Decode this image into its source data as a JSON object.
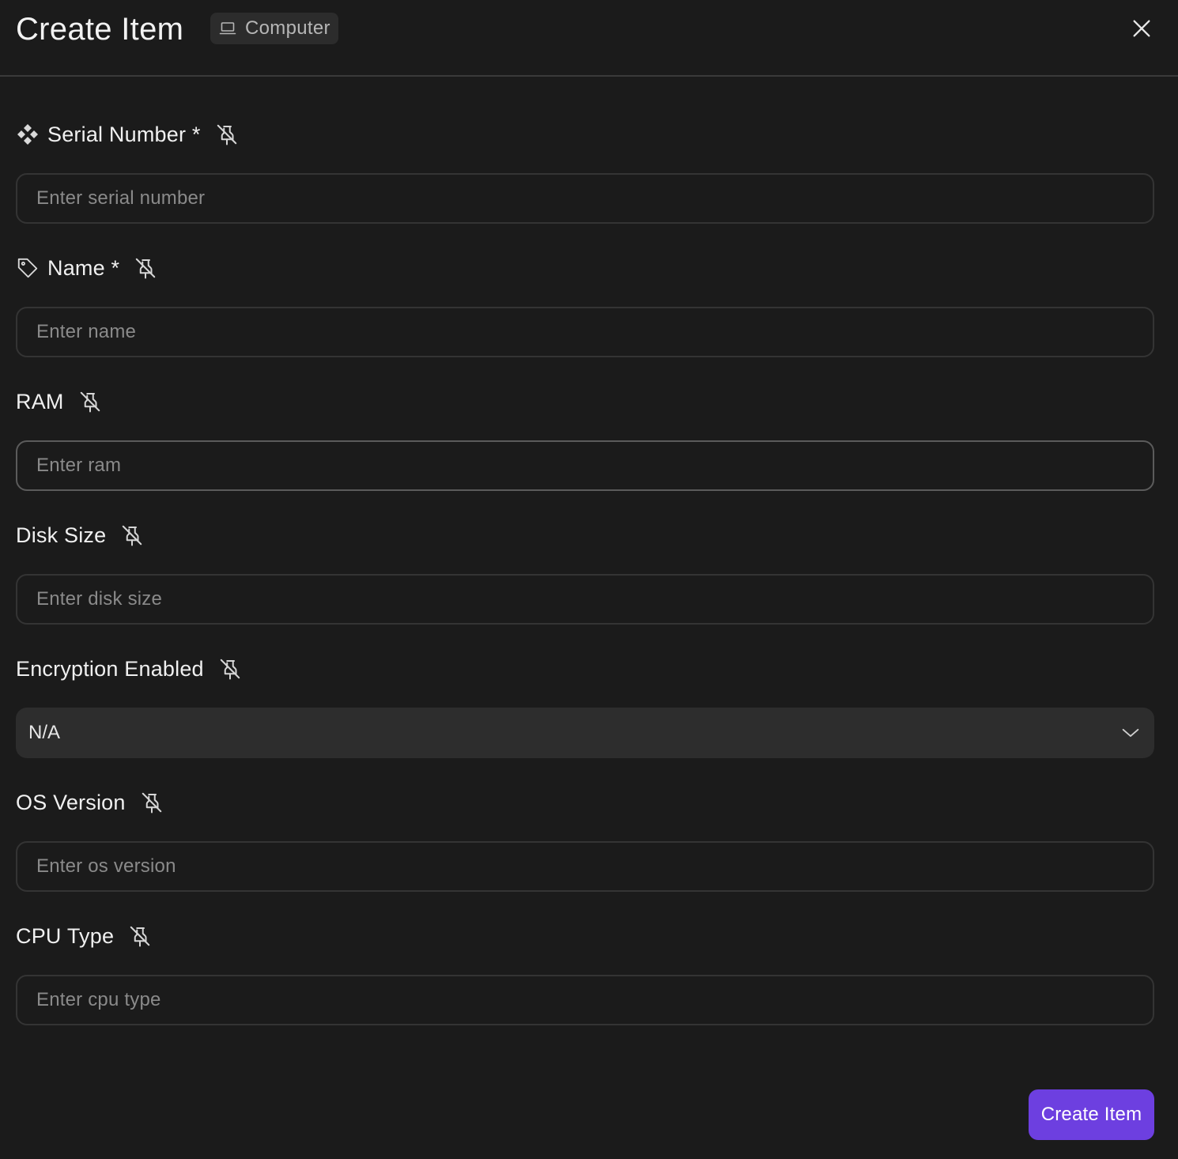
{
  "header": {
    "title": "Create Item",
    "badge_label": "Computer",
    "badge_icon": "laptop-icon",
    "close_icon": "close-icon"
  },
  "fields": [
    {
      "key": "serial_number",
      "label": "Serial Number *",
      "placeholder": "Enter serial number",
      "value": "",
      "icon": "component-icon"
    },
    {
      "key": "name",
      "label": "Name *",
      "placeholder": "Enter name",
      "value": "",
      "icon": "tag-icon"
    },
    {
      "key": "ram",
      "label": "RAM",
      "placeholder": "Enter ram",
      "value": ""
    },
    {
      "key": "disk_size",
      "label": "Disk Size",
      "placeholder": "Enter disk size",
      "value": ""
    },
    {
      "key": "encryption_enabled",
      "label": "Encryption Enabled",
      "type": "select",
      "selected": "N/A"
    },
    {
      "key": "os_version",
      "label": "OS Version",
      "placeholder": "Enter os version",
      "value": ""
    },
    {
      "key": "cpu_type",
      "label": "CPU Type",
      "placeholder": "Enter cpu type",
      "value": ""
    }
  ],
  "footer": {
    "submit_label": "Create Item"
  },
  "colors": {
    "background": "#1b1b1b",
    "accent": "#6d3fe0",
    "input_border": "#343434",
    "select_bg": "#2d2d2d",
    "placeholder": "#8a8a8a"
  }
}
